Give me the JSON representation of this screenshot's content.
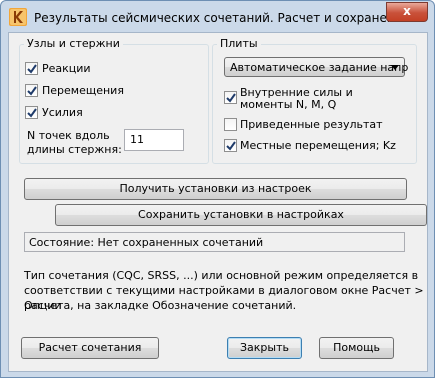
{
  "window": {
    "title": "Результаты сейсмических сочетаний. Расчет и сохранение",
    "close_label": "x"
  },
  "nodes_group": {
    "title": "Узлы и стержни",
    "reactions": {
      "label": "Реакции",
      "checked": true
    },
    "displacements": {
      "label": "Перемещения",
      "checked": true
    },
    "forces": {
      "label": "Усилия",
      "checked": true
    },
    "points_label_line1": "N точек вдоль",
    "points_label_line2": "длины стержня:",
    "points_value": "11"
  },
  "plates_group": {
    "title": "Плиты",
    "mode_selected": "Автоматическое задание напр",
    "internal_forces": {
      "label_line1": "Внутренние силы и",
      "label_line2": "моменты  N, M, Q",
      "checked": true
    },
    "reduced_results": {
      "label": "Приведенные результат",
      "checked": false
    },
    "local_displacements": {
      "label": "Местные перемещения; Kz",
      "checked": true
    }
  },
  "buttons": {
    "get_settings": "Получить установки из настроек",
    "save_settings": "Сохранить установки в настройках",
    "calculate": "Расчет сочетания",
    "close": "Закрыть",
    "help": "Помощь"
  },
  "status": "Состояние: Нет сохраненных сочетаний",
  "note": {
    "line1": "Тип сочетания (CQC, SRSS, ...) или основной режим определяется в",
    "line2": "соответствии с текущими настройками в диалоговом окне Расчет > Опции",
    "line3": "расчета, на закладке Обозначение сочетаний."
  },
  "colors": {
    "title_bar": "#cbd9e9",
    "dialog_bg": "#f0f0f0",
    "close_button": "#c9513a"
  },
  "icons": {
    "app": "robot-app-icon",
    "close": "close-icon",
    "check": "checkmark-icon",
    "dropdown": "chevron-down-icon"
  }
}
